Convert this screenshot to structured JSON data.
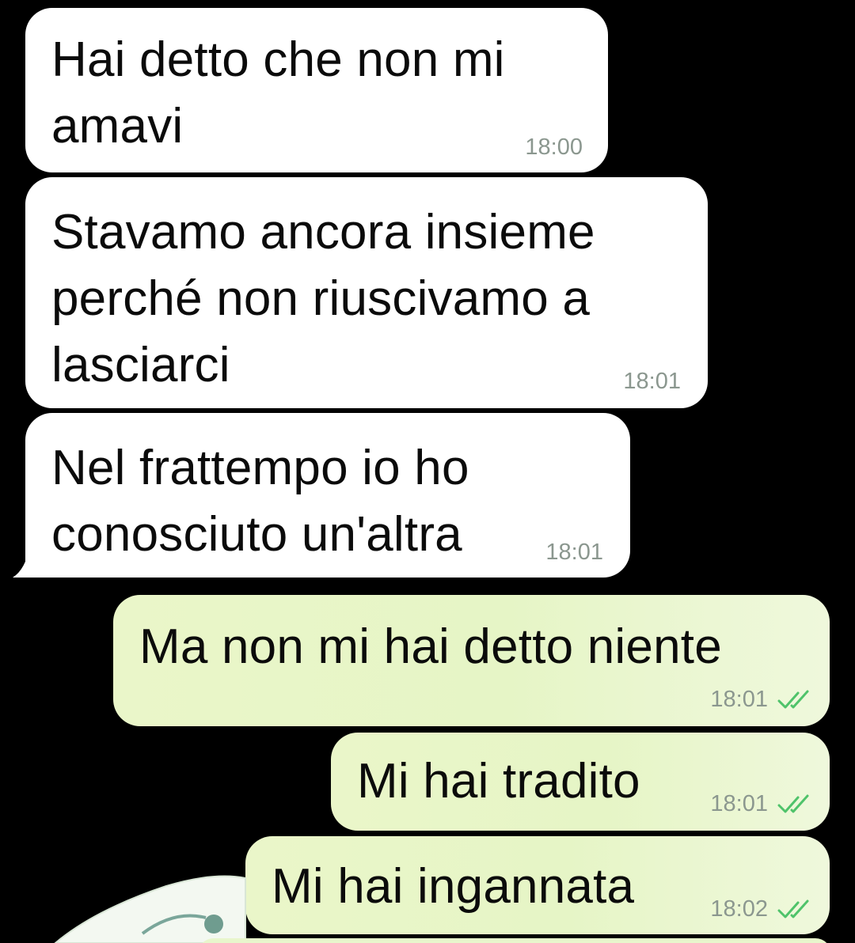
{
  "chat": {
    "messages": [
      {
        "direction": "incoming",
        "text": "Hai detto che non mi\namavi",
        "time": "18:00"
      },
      {
        "direction": "incoming",
        "text": "Stavamo ancora insieme\nperché non riuscivamo a\nlasciarci",
        "time": "18:01"
      },
      {
        "direction": "incoming",
        "text": "Nel frattempo io ho\nconosciuto un'altra",
        "time": "18:01"
      },
      {
        "direction": "outgoing",
        "text": "Ma non mi hai detto niente",
        "time": "18:01",
        "status_icon": "double-check-icon"
      },
      {
        "direction": "outgoing",
        "text": "Mi hai tradito",
        "time": "18:01",
        "status_icon": "double-check-icon"
      },
      {
        "direction": "outgoing",
        "text": "Mi hai ingannata",
        "time": "18:02",
        "status_icon": "double-check-icon"
      }
    ]
  },
  "colors": {
    "background": "#000000",
    "incoming_bubble": "#ffffff",
    "outgoing_bubble": "#e6f5c6",
    "timestamp": "#8b978f",
    "read_ticks": "#4fc36a"
  }
}
